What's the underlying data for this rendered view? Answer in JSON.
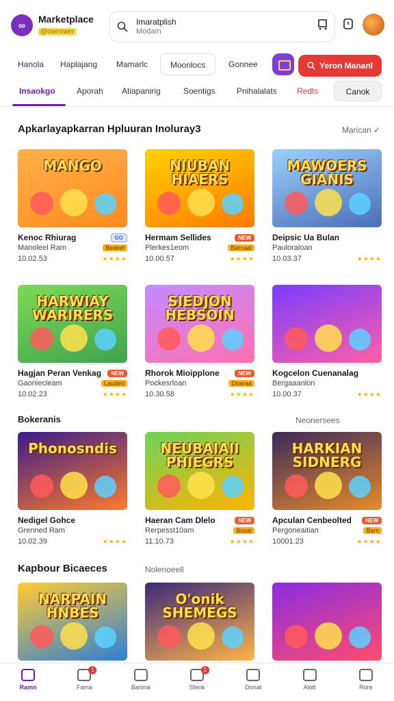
{
  "header": {
    "brand_name": "Marketplace",
    "brand_tag": "@ownswer",
    "search_text": "Imaratplish",
    "search_placeholder": "Modam"
  },
  "chips": {
    "items": [
      "Hanola",
      "Haplajang",
      "Mamarlc",
      "Moonlocs",
      "Gonnee"
    ],
    "primary_button": "Yeron Mananl"
  },
  "tabs": {
    "items": [
      "Insaokgo",
      "Aporah",
      "Atiapanirig",
      "Soentigs",
      "Pnihalalats",
      "Redts"
    ],
    "active_index": 0,
    "button": "Canok"
  },
  "sections": [
    {
      "title": "Apkarlayapkarran Hpluuran Inoluray3",
      "sub": "Marican",
      "cards": [
        {
          "title": "Kenoc Rhiurag",
          "badge": "GO",
          "sub": "Manoleel Ram",
          "tag": "Bedeel",
          "meta": "10.02.53",
          "art": "MANGO"
        },
        {
          "title": "Hermam Sellides",
          "badge": "NEW",
          "sub": "Plerkes1eom",
          "tag": "Barcaal",
          "meta": "10.00.57",
          "art": "NIUBAN HIAERS"
        },
        {
          "title": "Deipsic Ua Bulan",
          "badge": "",
          "sub": "Pauloraloan",
          "tag": "",
          "meta": "10.03.37",
          "art": "MAWOERS GIANIS"
        }
      ]
    },
    {
      "title": "",
      "sub": "",
      "cards": [
        {
          "title": "Hagjan Peran Venkag",
          "badge": "NEW",
          "sub": "Gaoniecleam",
          "tag": "Lauded",
          "meta": "10.02.23",
          "art": "HARWIAY WARIRERS"
        },
        {
          "title": "Rhorok Mioipplone",
          "badge": "NEW",
          "sub": "Pockesrloan",
          "tag": "Doaraa",
          "meta": "10.30.58",
          "art": "SIEDJON HEBSOIN"
        },
        {
          "title": "Kogcelon Cuenanalag",
          "badge": "",
          "sub": "Bergaaanlon",
          "tag": "",
          "meta": "10.00.37",
          "art": ""
        }
      ]
    },
    {
      "title": "Bokeranis",
      "sub": "Neonersees",
      "cards": [
        {
          "title": "Nedigel Gohce",
          "badge": "",
          "sub": "Grenned Ram",
          "tag": "",
          "meta": "10.02.39",
          "art": "Phonosndis"
        },
        {
          "title": "Haeran Cam Dlelo",
          "badge": "NEW",
          "sub": "Rerpesst10am",
          "tag": "Bosai",
          "meta": "11.10.73",
          "art": "NEUBAIAII PHIEGRS"
        },
        {
          "title": "Apculan Cenbeolted",
          "badge": "NEW",
          "sub": "Pergoneaitian",
          "tag": "Bam",
          "meta": "10001.23",
          "art": "HARKIAN SIDNERG"
        }
      ]
    },
    {
      "title": "Kapbour Bicaeces",
      "sub": "Nolenoeell",
      "cards": [
        {
          "title": "",
          "badge": "",
          "sub": "",
          "tag": "",
          "meta": "",
          "art": "NARPAIN HNBES"
        },
        {
          "title": "",
          "badge": "",
          "sub": "",
          "tag": "",
          "meta": "",
          "art": "O'onik SHEMEGS"
        },
        {
          "title": "",
          "badge": "",
          "sub": "",
          "tag": "",
          "meta": "",
          "art": ""
        }
      ]
    }
  ],
  "bottom_nav": [
    {
      "label": "Ramn",
      "icon": "home-icon",
      "active": true,
      "badge": ""
    },
    {
      "label": "Fama",
      "icon": "store-icon",
      "active": false,
      "badge": "1"
    },
    {
      "label": "Banina",
      "icon": "games-icon",
      "active": false,
      "badge": ""
    },
    {
      "label": "Sfenk",
      "icon": "list-icon",
      "active": false,
      "badge": "1"
    },
    {
      "label": "Donat",
      "icon": "bag-icon",
      "active": false,
      "badge": ""
    },
    {
      "label": "Alott",
      "icon": "search-icon",
      "active": false,
      "badge": ""
    },
    {
      "label": "Rore",
      "icon": "profile-icon",
      "active": false,
      "badge": ""
    }
  ],
  "colors": {
    "accent": "#6a1fb2",
    "primary_red": "#e53935",
    "star": "#f5b800"
  }
}
